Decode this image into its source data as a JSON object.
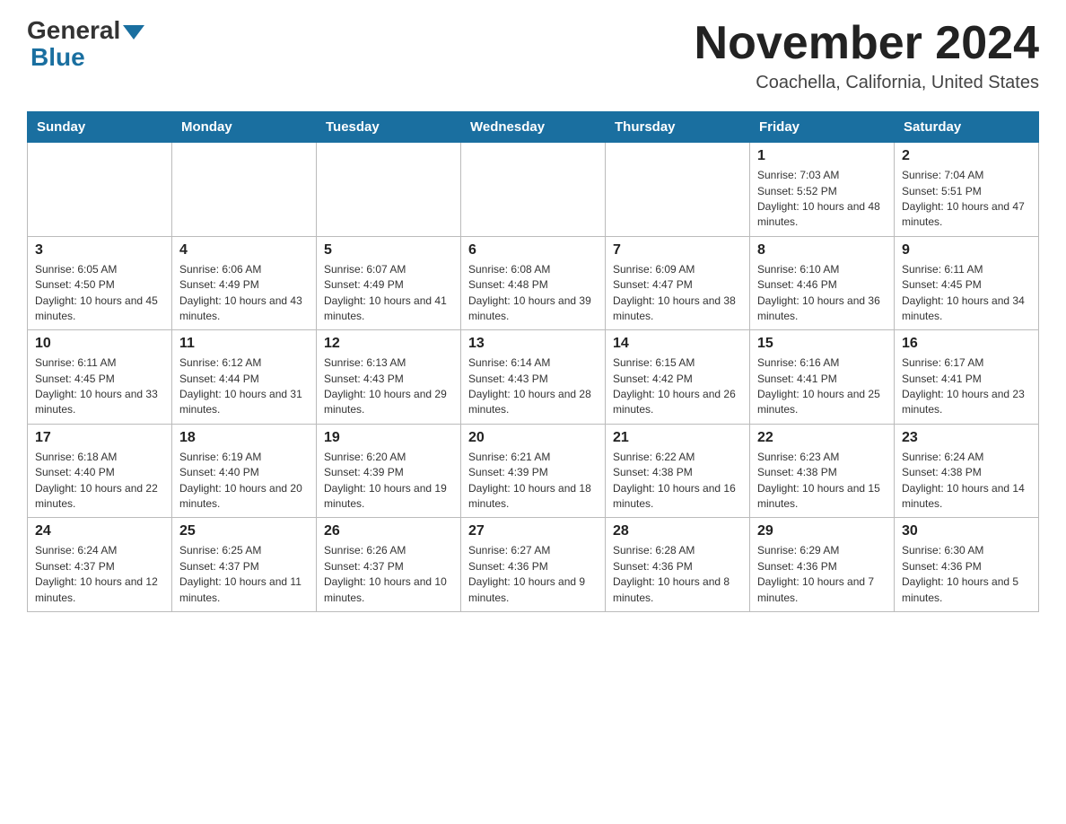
{
  "header": {
    "logo_general": "General",
    "logo_blue": "Blue",
    "month_title": "November 2024",
    "location": "Coachella, California, United States"
  },
  "weekdays": [
    "Sunday",
    "Monday",
    "Tuesday",
    "Wednesday",
    "Thursday",
    "Friday",
    "Saturday"
  ],
  "weeks": [
    [
      {
        "day": "",
        "info": ""
      },
      {
        "day": "",
        "info": ""
      },
      {
        "day": "",
        "info": ""
      },
      {
        "day": "",
        "info": ""
      },
      {
        "day": "",
        "info": ""
      },
      {
        "day": "1",
        "info": "Sunrise: 7:03 AM\nSunset: 5:52 PM\nDaylight: 10 hours and 48 minutes."
      },
      {
        "day": "2",
        "info": "Sunrise: 7:04 AM\nSunset: 5:51 PM\nDaylight: 10 hours and 47 minutes."
      }
    ],
    [
      {
        "day": "3",
        "info": "Sunrise: 6:05 AM\nSunset: 4:50 PM\nDaylight: 10 hours and 45 minutes."
      },
      {
        "day": "4",
        "info": "Sunrise: 6:06 AM\nSunset: 4:49 PM\nDaylight: 10 hours and 43 minutes."
      },
      {
        "day": "5",
        "info": "Sunrise: 6:07 AM\nSunset: 4:49 PM\nDaylight: 10 hours and 41 minutes."
      },
      {
        "day": "6",
        "info": "Sunrise: 6:08 AM\nSunset: 4:48 PM\nDaylight: 10 hours and 39 minutes."
      },
      {
        "day": "7",
        "info": "Sunrise: 6:09 AM\nSunset: 4:47 PM\nDaylight: 10 hours and 38 minutes."
      },
      {
        "day": "8",
        "info": "Sunrise: 6:10 AM\nSunset: 4:46 PM\nDaylight: 10 hours and 36 minutes."
      },
      {
        "day": "9",
        "info": "Sunrise: 6:11 AM\nSunset: 4:45 PM\nDaylight: 10 hours and 34 minutes."
      }
    ],
    [
      {
        "day": "10",
        "info": "Sunrise: 6:11 AM\nSunset: 4:45 PM\nDaylight: 10 hours and 33 minutes."
      },
      {
        "day": "11",
        "info": "Sunrise: 6:12 AM\nSunset: 4:44 PM\nDaylight: 10 hours and 31 minutes."
      },
      {
        "day": "12",
        "info": "Sunrise: 6:13 AM\nSunset: 4:43 PM\nDaylight: 10 hours and 29 minutes."
      },
      {
        "day": "13",
        "info": "Sunrise: 6:14 AM\nSunset: 4:43 PM\nDaylight: 10 hours and 28 minutes."
      },
      {
        "day": "14",
        "info": "Sunrise: 6:15 AM\nSunset: 4:42 PM\nDaylight: 10 hours and 26 minutes."
      },
      {
        "day": "15",
        "info": "Sunrise: 6:16 AM\nSunset: 4:41 PM\nDaylight: 10 hours and 25 minutes."
      },
      {
        "day": "16",
        "info": "Sunrise: 6:17 AM\nSunset: 4:41 PM\nDaylight: 10 hours and 23 minutes."
      }
    ],
    [
      {
        "day": "17",
        "info": "Sunrise: 6:18 AM\nSunset: 4:40 PM\nDaylight: 10 hours and 22 minutes."
      },
      {
        "day": "18",
        "info": "Sunrise: 6:19 AM\nSunset: 4:40 PM\nDaylight: 10 hours and 20 minutes."
      },
      {
        "day": "19",
        "info": "Sunrise: 6:20 AM\nSunset: 4:39 PM\nDaylight: 10 hours and 19 minutes."
      },
      {
        "day": "20",
        "info": "Sunrise: 6:21 AM\nSunset: 4:39 PM\nDaylight: 10 hours and 18 minutes."
      },
      {
        "day": "21",
        "info": "Sunrise: 6:22 AM\nSunset: 4:38 PM\nDaylight: 10 hours and 16 minutes."
      },
      {
        "day": "22",
        "info": "Sunrise: 6:23 AM\nSunset: 4:38 PM\nDaylight: 10 hours and 15 minutes."
      },
      {
        "day": "23",
        "info": "Sunrise: 6:24 AM\nSunset: 4:38 PM\nDaylight: 10 hours and 14 minutes."
      }
    ],
    [
      {
        "day": "24",
        "info": "Sunrise: 6:24 AM\nSunset: 4:37 PM\nDaylight: 10 hours and 12 minutes."
      },
      {
        "day": "25",
        "info": "Sunrise: 6:25 AM\nSunset: 4:37 PM\nDaylight: 10 hours and 11 minutes."
      },
      {
        "day": "26",
        "info": "Sunrise: 6:26 AM\nSunset: 4:37 PM\nDaylight: 10 hours and 10 minutes."
      },
      {
        "day": "27",
        "info": "Sunrise: 6:27 AM\nSunset: 4:36 PM\nDaylight: 10 hours and 9 minutes."
      },
      {
        "day": "28",
        "info": "Sunrise: 6:28 AM\nSunset: 4:36 PM\nDaylight: 10 hours and 8 minutes."
      },
      {
        "day": "29",
        "info": "Sunrise: 6:29 AM\nSunset: 4:36 PM\nDaylight: 10 hours and 7 minutes."
      },
      {
        "day": "30",
        "info": "Sunrise: 6:30 AM\nSunset: 4:36 PM\nDaylight: 10 hours and 5 minutes."
      }
    ]
  ]
}
